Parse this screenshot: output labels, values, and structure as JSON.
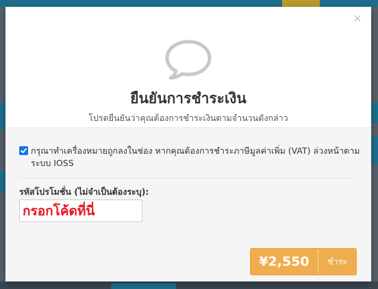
{
  "modal": {
    "close_symbol": "×",
    "icon": "speech-bubble-icon",
    "title": "ยืนยันการชำระเงิน",
    "subtitle": "โปรดยืนยันว่าคุณต้องการชำระเงินตามจำนวนดังกล่าว",
    "vat": {
      "checked": true,
      "text": "กรุณาทำเครื่องหมายถูกลงในช่อง หากคุณต้องการชำระภาษีมูลค่าเพิ่ม (VAT) ล่วงหน้าตามระบบ IOSS"
    },
    "promo": {
      "label": "รหัสโปรโมชั่น (ไม่จำเป็นต้องระบุ):",
      "value": "กรอกโค้ดที่นี่"
    },
    "pay": {
      "amount": "¥2,550",
      "label": "ชำระ"
    }
  },
  "colors": {
    "pay_button": "#f0ad4e",
    "promo_text": "#e8141f",
    "checkbox": "#1a73e8"
  }
}
